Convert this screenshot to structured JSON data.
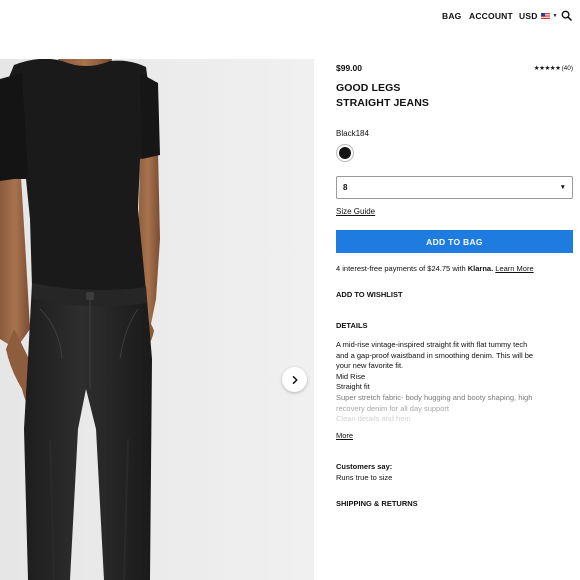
{
  "nav": {
    "bag": "BAG",
    "account": "ACCOUNT",
    "currency": "USD"
  },
  "product": {
    "price": "$99.00",
    "rating_stars": "★★★★★",
    "rating_count": "(40)",
    "title_line1": "GOOD LEGS",
    "title_line2": "STRAIGHT JEANS",
    "color_name": "Black184",
    "swatch_color": "#141414",
    "size_selected": "8",
    "size_guide_label": "Size Guide",
    "add_to_bag_label": "ADD TO BAG",
    "klarna_prefix": "4 interest-free payments of $24.75 with ",
    "klarna_brand": "Klarna.",
    "klarna_link": "Learn More",
    "wishlist_label": "ADD TO WISHLIST",
    "details_heading": "DETAILS",
    "details_lines": [
      "A mid-rise vintage-inspired straight fit with flat tummy tech",
      "and a gap-proof waistband in smoothing denim. This will be",
      "your new favorite fit.",
      "Mid Rise",
      "Straight fit",
      "Super stretch fabric- body hugging and booty shaping, high",
      "recovery denim for all day support",
      "Clean details and hem"
    ],
    "more_label": "More",
    "customers_heading": "Customers say:",
    "customers_text": "Runs true to size",
    "shipping_label": "SHIPPING & RETURNS"
  },
  "colors": {
    "accent": "#1e7ce0",
    "text": "#111111"
  }
}
